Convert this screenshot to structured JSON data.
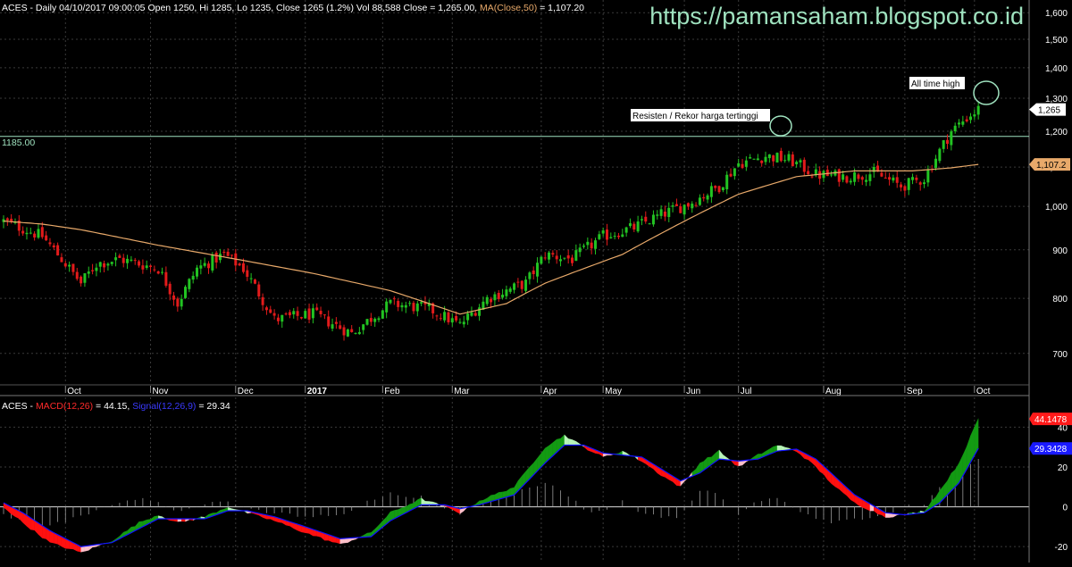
{
  "header": {
    "symbol": "ACES",
    "info": " - Daily 04/10/2017 09:00:05 Open 1250, Hi 1285, Lo 1235, Close 1265 (1.2%) Vol 88,588 Close = 1,265.00, ",
    "ma_text": "MA(Close,50)",
    "ma_value": " = 1,107.20",
    "watermark": "https://pamansaham.blogspot.co.id"
  },
  "colors": {
    "background": "#000000",
    "grid": "#3a3a3a",
    "candle_up": "#22c322",
    "candle_down": "#e21b1b",
    "ma": "#e8a96a",
    "resistance": "#9fe2bf",
    "watermark": "#9fe2bf",
    "macd_bull_fill": "#139a13",
    "macd_bull_light": "#b8f5b8",
    "macd_bear_fill": "#ff1010",
    "macd_bear_light": "#ffc0cb",
    "signal_line": "#1010ff",
    "histogram": "#9a9a9a"
  },
  "chart_data": [
    {
      "type": "candlestick",
      "ylim": [
        650,
        1650
      ],
      "yticks": [
        700,
        800,
        900,
        1000,
        1100,
        1200,
        1300,
        1400,
        1500,
        1600
      ],
      "ytick_labels": [
        "700",
        "800",
        "900",
        "1,000",
        "1,100",
        "1,200",
        "1,300",
        "1,400",
        "1,500",
        "1,600"
      ],
      "xticks": [
        {
          "label": "Oct",
          "i": 16
        },
        {
          "label": "Nov",
          "i": 38
        },
        {
          "label": "Dec",
          "i": 60
        },
        {
          "label": "2017",
          "i": 78
        },
        {
          "label": "Feb",
          "i": 98
        },
        {
          "label": "Mar",
          "i": 116
        },
        {
          "label": "Apr",
          "i": 139
        },
        {
          "label": "May",
          "i": 155
        },
        {
          "label": "Jun",
          "i": 176
        },
        {
          "label": "Jul",
          "i": 190
        },
        {
          "label": "Aug",
          "i": 212
        },
        {
          "label": "Sep",
          "i": 233
        },
        {
          "label": "Oct",
          "i": 251
        }
      ],
      "close_anchors": [
        [
          0,
          965
        ],
        [
          10,
          930
        ],
        [
          20,
          830
        ],
        [
          24,
          870
        ],
        [
          30,
          880
        ],
        [
          40,
          860
        ],
        [
          45,
          790
        ],
        [
          50,
          860
        ],
        [
          57,
          890
        ],
        [
          62,
          860
        ],
        [
          70,
          760
        ],
        [
          80,
          770
        ],
        [
          90,
          735
        ],
        [
          100,
          790
        ],
        [
          110,
          780
        ],
        [
          118,
          750
        ],
        [
          125,
          800
        ],
        [
          135,
          830
        ],
        [
          140,
          890
        ],
        [
          147,
          880
        ],
        [
          155,
          930
        ],
        [
          163,
          950
        ],
        [
          170,
          980
        ],
        [
          178,
          1010
        ],
        [
          185,
          1050
        ],
        [
          190,
          1110
        ],
        [
          197,
          1130
        ],
        [
          203,
          1120
        ],
        [
          210,
          1080
        ],
        [
          218,
          1075
        ],
        [
          225,
          1085
        ],
        [
          232,
          1050
        ],
        [
          238,
          1070
        ],
        [
          245,
          1200
        ],
        [
          249,
          1240
        ],
        [
          252,
          1265
        ]
      ],
      "ma_anchors": [
        [
          0,
          965
        ],
        [
          10,
          958
        ],
        [
          20,
          945
        ],
        [
          40,
          910
        ],
        [
          60,
          880
        ],
        [
          80,
          850
        ],
        [
          100,
          815
        ],
        [
          110,
          790
        ],
        [
          118,
          770
        ],
        [
          130,
          790
        ],
        [
          140,
          830
        ],
        [
          160,
          890
        ],
        [
          175,
          960
        ],
        [
          190,
          1030
        ],
        [
          205,
          1075
        ],
        [
          220,
          1090
        ],
        [
          235,
          1090
        ],
        [
          245,
          1098
        ],
        [
          252,
          1107.2
        ]
      ],
      "last_close": 1265,
      "last_close_label": "1,265",
      "ma_last": 1107.2,
      "ma_last_label": "1,107.2",
      "resistance": 1185,
      "resistance_label": "1185.00",
      "annotations": {
        "resistance_note": "Resisten / Rekor harga tertinggi",
        "ath_note": "All time high"
      }
    },
    {
      "type": "macd",
      "ylim": [
        -28,
        55
      ],
      "yticks": [
        -20,
        0,
        20,
        40
      ],
      "ytick_labels": [
        "-20",
        "0",
        "20",
        "40"
      ],
      "macd_label": "MACD(12,26)",
      "macd_value": " = 44.15,",
      "signal_label": "Signal(12,26,9)",
      "signal_value": " = 29.34",
      "macd_last_label": "44.1478",
      "signal_last_label": "29.3428",
      "macd_anchors": [
        [
          0,
          0
        ],
        [
          5,
          -8
        ],
        [
          12,
          -18
        ],
        [
          20,
          -23
        ],
        [
          28,
          -17
        ],
        [
          35,
          -8
        ],
        [
          40,
          -4
        ],
        [
          45,
          -8
        ],
        [
          52,
          -5
        ],
        [
          58,
          0
        ],
        [
          63,
          -3
        ],
        [
          70,
          -7
        ],
        [
          78,
          -13
        ],
        [
          87,
          -19
        ],
        [
          95,
          -13
        ],
        [
          100,
          -3
        ],
        [
          108,
          4
        ],
        [
          114,
          0
        ],
        [
          118,
          -3
        ],
        [
          123,
          3
        ],
        [
          132,
          10
        ],
        [
          140,
          30
        ],
        [
          145,
          36
        ],
        [
          150,
          30
        ],
        [
          155,
          25
        ],
        [
          160,
          28
        ],
        [
          165,
          23
        ],
        [
          170,
          16
        ],
        [
          175,
          10
        ],
        [
          180,
          22
        ],
        [
          185,
          28
        ],
        [
          190,
          20
        ],
        [
          195,
          26
        ],
        [
          200,
          31
        ],
        [
          205,
          28
        ],
        [
          210,
          20
        ],
        [
          215,
          10
        ],
        [
          220,
          2
        ],
        [
          228,
          -5
        ],
        [
          233,
          -4
        ],
        [
          238,
          -2
        ],
        [
          242,
          8
        ],
        [
          247,
          22
        ],
        [
          252,
          44.15
        ]
      ],
      "signal_anchors": [
        [
          0,
          2
        ],
        [
          5,
          -3
        ],
        [
          12,
          -12
        ],
        [
          20,
          -20
        ],
        [
          28,
          -18
        ],
        [
          35,
          -11
        ],
        [
          40,
          -6
        ],
        [
          45,
          -6
        ],
        [
          52,
          -6
        ],
        [
          58,
          -2
        ],
        [
          63,
          -2
        ],
        [
          70,
          -5
        ],
        [
          78,
          -10
        ],
        [
          87,
          -16
        ],
        [
          95,
          -15
        ],
        [
          100,
          -7
        ],
        [
          108,
          1
        ],
        [
          114,
          1
        ],
        [
          118,
          -1
        ],
        [
          123,
          1
        ],
        [
          132,
          6
        ],
        [
          140,
          22
        ],
        [
          145,
          31
        ],
        [
          150,
          31
        ],
        [
          155,
          27
        ],
        [
          160,
          26
        ],
        [
          165,
          25
        ],
        [
          170,
          19
        ],
        [
          175,
          13
        ],
        [
          180,
          17
        ],
        [
          185,
          24
        ],
        [
          190,
          23
        ],
        [
          195,
          24
        ],
        [
          200,
          28
        ],
        [
          205,
          29
        ],
        [
          210,
          24
        ],
        [
          215,
          15
        ],
        [
          220,
          6
        ],
        [
          228,
          -3
        ],
        [
          233,
          -4
        ],
        [
          238,
          -3
        ],
        [
          242,
          2
        ],
        [
          247,
          12
        ],
        [
          252,
          29.34
        ]
      ]
    }
  ]
}
